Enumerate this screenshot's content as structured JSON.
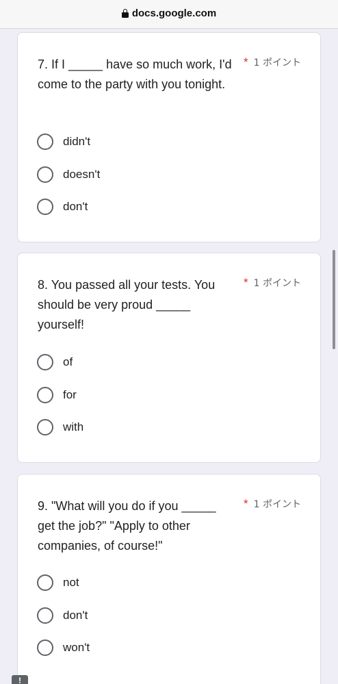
{
  "browser": {
    "url": "docs.google.com",
    "lock_icon": "lock-icon"
  },
  "questions": [
    {
      "title": "7. If I _____ have so much work, I'd come to the party with you tonight.",
      "required_mark": "*",
      "points": "1 ポイント",
      "options": [
        "didn't",
        "doesn't",
        "don't"
      ]
    },
    {
      "title": "8. You passed all your tests. You should be very proud _____ yourself!",
      "required_mark": "*",
      "points": "1 ポイント",
      "options": [
        "of",
        "for",
        "with"
      ]
    },
    {
      "title": "9. \"What will you do if you _____ get the job?\" \"Apply to other companies, of course!\"",
      "required_mark": "*",
      "points": "1 ポイント",
      "options": [
        "not",
        "don't",
        "won't"
      ]
    }
  ],
  "report_badge": "!",
  "colors": {
    "page_bg": "#efeef7",
    "required": "#d93025",
    "radio_border": "#5f6368"
  }
}
